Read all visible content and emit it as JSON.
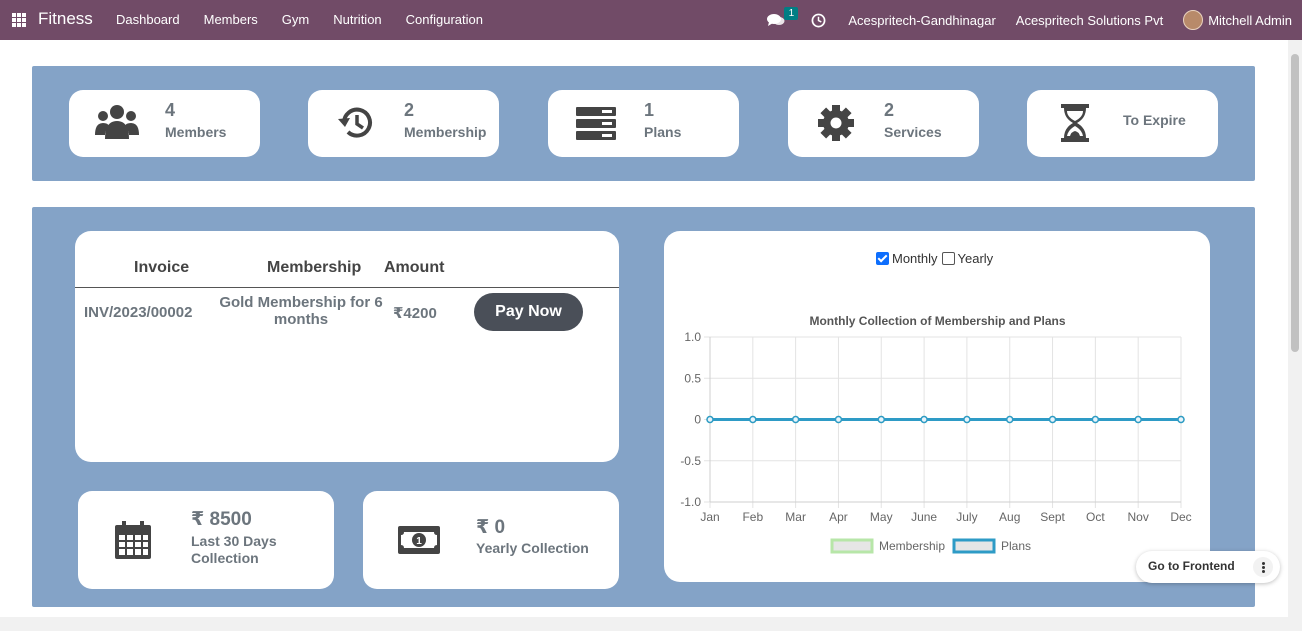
{
  "navbar": {
    "brand": "Fitness",
    "menu": [
      "Dashboard",
      "Members",
      "Gym",
      "Nutrition",
      "Configuration"
    ],
    "chat_count": "1",
    "company_branch": "Acespritech-Gandhinagar",
    "company_name": "Acespritech Solutions Pvt",
    "user": "Mitchell Admin",
    "color": "#714B67"
  },
  "stats": [
    {
      "value": "4",
      "label": "Members",
      "icon": "users-icon"
    },
    {
      "value": "2",
      "label": "Membership",
      "icon": "history-icon"
    },
    {
      "value": "1",
      "label": "Plans",
      "icon": "server-icon"
    },
    {
      "value": "2",
      "label": "Services",
      "icon": "gear-icon"
    },
    {
      "value": "",
      "label": "To Expire",
      "icon": "hourglass-icon"
    }
  ],
  "invoices": {
    "headers": [
      "Invoice",
      "Membership",
      "Amount"
    ],
    "rows": [
      {
        "invoice": "INV/2023/00002",
        "membership_line1": "Gold Membership for 6",
        "membership_line2": "months",
        "amount": "₹4200",
        "action": "Pay Now"
      }
    ]
  },
  "collections": {
    "last30_amount": "₹ 8500",
    "last30_line1": "Last 30 Days",
    "last30_line2": "Collection",
    "yearly_amount": "₹ 0",
    "yearly_label": "Yearly Collection"
  },
  "toggles": {
    "monthly_label": "Monthly",
    "monthly_checked": true,
    "yearly_label": "Yearly",
    "yearly_checked": false
  },
  "go_frontend": "Go to Frontend",
  "chart_data": {
    "type": "line",
    "title": "Monthly Collection of Membership and Plans",
    "categories": [
      "Jan",
      "Feb",
      "Mar",
      "Apr",
      "May",
      "June",
      "July",
      "Aug",
      "Sept",
      "Oct",
      "Nov",
      "Dec"
    ],
    "yticks": [
      "1.0",
      "0.5",
      "0",
      "-0.5",
      "-1.0"
    ],
    "ylim": [
      -1.0,
      1.0
    ],
    "grid": true,
    "legend_position": "bottom",
    "series": [
      {
        "name": "Membership",
        "values": [
          0,
          0,
          0,
          0,
          0,
          0,
          0,
          0,
          0,
          0,
          0,
          0
        ],
        "color": "#b7e6a8"
      },
      {
        "name": "Plans",
        "values": [
          0,
          0,
          0,
          0,
          0,
          0,
          0,
          0,
          0,
          0,
          0,
          0
        ],
        "color": "#2e9bc6"
      }
    ]
  }
}
